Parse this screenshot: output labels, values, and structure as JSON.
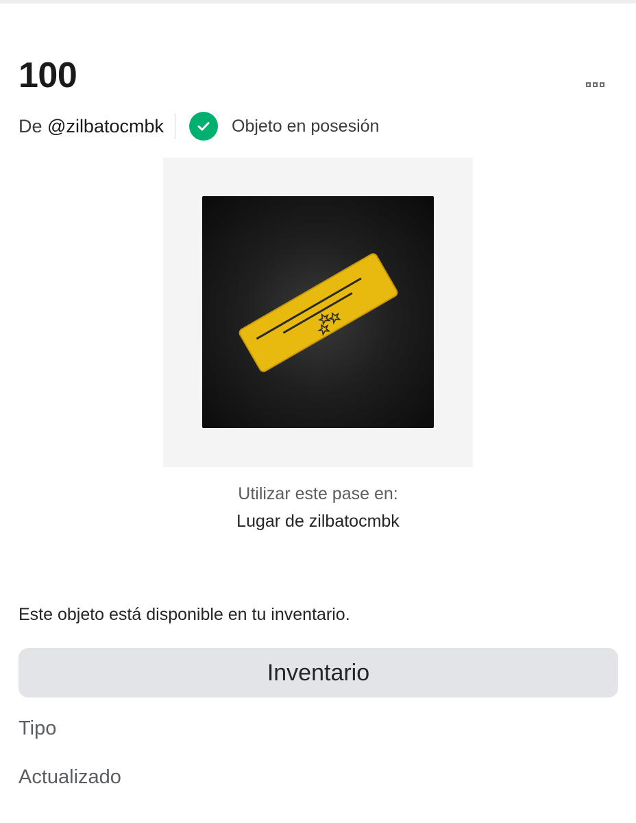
{
  "item": {
    "title": "100",
    "creator_prefix": "De",
    "creator_handle": "@zilbatocmbk",
    "owned_status": "Objeto en posesión"
  },
  "thumbnail": {
    "icon": "gold-ticket-pass-icon",
    "colors": {
      "ticket": "#e8b90e",
      "background": "#1a1a1a"
    }
  },
  "usage": {
    "label": "Utilizar este pase en:",
    "place": "Lugar de zilbatocmbk"
  },
  "inventory": {
    "note": "Este objeto está disponible en tu inventario.",
    "button_label": "Inventario"
  },
  "details": {
    "type_label": "Tipo",
    "updated_label": "Actualizado"
  },
  "icons": {
    "more": "more-options-icon",
    "owned": "checkmark-circle-icon"
  },
  "colors": {
    "owned_green": "#00b06f",
    "button_bg": "#e3e4e8"
  }
}
